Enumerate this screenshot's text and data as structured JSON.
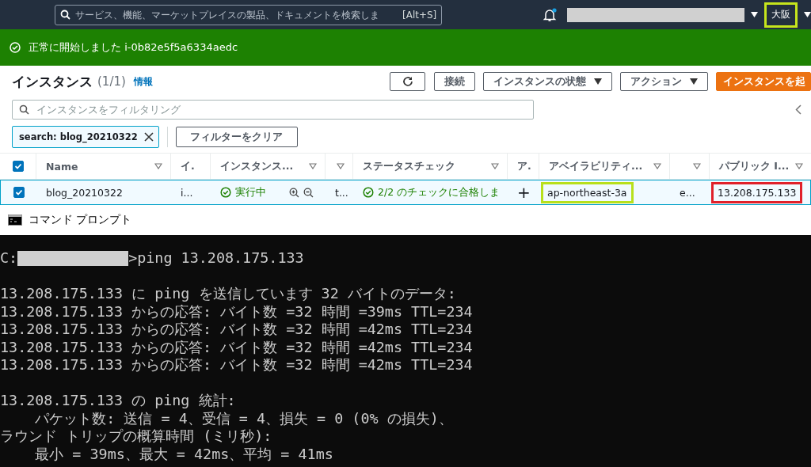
{
  "top_nav": {
    "search_placeholder": "サービス、機能、マーケットプレイスの製品、ドキュメントを検索しま",
    "shortcut": "[Alt+S]",
    "notification_unread": true,
    "region": "大阪"
  },
  "banner": {
    "kind": "success",
    "message": "正常に開始しました i-0b82e5f5a6334aedc"
  },
  "instances": {
    "title": "インスタンス",
    "count": "(1/1)",
    "info_link": "情報",
    "buttons": [
      {
        "kind": "refresh"
      },
      {
        "kind": "plain",
        "label": "接続"
      },
      {
        "kind": "dropdown",
        "label": "インスタンスの状態"
      },
      {
        "kind": "dropdown",
        "label": "アクション"
      },
      {
        "kind": "primary",
        "label": "インスタンスを起"
      }
    ],
    "filter_placeholder": "インスタンスをフィルタリング",
    "filter_token": "search: blog_20210322",
    "clear_filter": "フィルターをクリア"
  },
  "table": {
    "all_checked": true,
    "columns": [
      {
        "label": "Name",
        "sortable": true
      },
      {
        "label": "イ.",
        "sortable": false
      },
      {
        "label": "インスタンス...",
        "sortable": true
      },
      {
        "sortable": true
      },
      {
        "label": "ステータスチェック",
        "sortable": true
      },
      {
        "label": "ア.",
        "sortable": false
      },
      {
        "label": "アベイラビリティ...",
        "sortable": true
      },
      {
        "sortable": true
      },
      {
        "label": "パブリック I...",
        "sortable": true
      }
    ],
    "rows": [
      {
        "selected": true,
        "checked": true,
        "cells": [
          {
            "kind": "text",
            "text": "blog_20210322"
          },
          {
            "kind": "text",
            "text": "i..."
          },
          {
            "kind": "state",
            "text": "実行中"
          },
          {
            "kind": "text",
            "text": "t..."
          },
          {
            "kind": "check",
            "text": "2/2 のチェックに合格しま"
          },
          {
            "kind": "add",
            "text": "+"
          },
          {
            "kind": "text",
            "text": "ap-northeast-3a",
            "color": "#b8e01c"
          },
          {
            "kind": "text",
            "text": "e..."
          },
          {
            "kind": "text",
            "text": "13.208.175.133",
            "color": "#e0202a"
          }
        ]
      }
    ]
  },
  "command_prompt": {
    "title": "コマンド プロンプト",
    "prompt_drive": "C:",
    "command": ">ping 13.208.175.133",
    "blocks": [
      [
        "13.208.175.133 に ping を送信しています 32 バイトのデータ:",
        "13.208.175.133 からの応答: バイト数 =32 時間 =39ms TTL=234",
        "13.208.175.133 からの応答: バイト数 =32 時間 =42ms TTL=234",
        "13.208.175.133 からの応答: バイト数 =32 時間 =42ms TTL=234",
        "13.208.175.133 からの応答: バイト数 =32 時間 =42ms TTL=234"
      ],
      [
        "13.208.175.133 の ping 統計:",
        "    パケット数: 送信 = 4、受信 = 4、損失 = 0 (0% の損失)、",
        "ラウンド トリップの概算時間 (ミリ秒):",
        "    最小 = 39ms、最大 = 42ms、平均 = 41ms"
      ]
    ]
  }
}
